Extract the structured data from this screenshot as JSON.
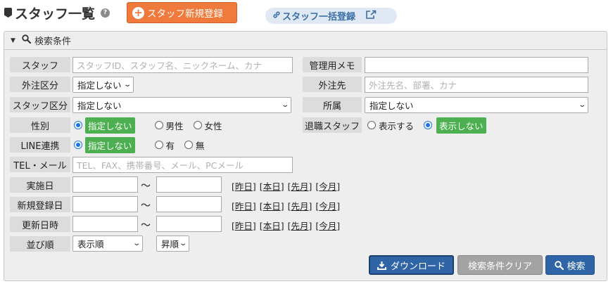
{
  "header": {
    "title": "スタッフ一覧",
    "help_icon": "?",
    "new_button": "スタッフ新規登録",
    "bulk_button": "スタッフ一括登録"
  },
  "panel": {
    "title": "検索条件"
  },
  "fields": {
    "staff": {
      "label": "スタッフ",
      "placeholder": "スタッフID、スタッフ名、ニックネーム、カナ"
    },
    "memo": {
      "label": "管理用メモ",
      "value": ""
    },
    "outsource_type": {
      "label": "外注区分",
      "value": "指定しない"
    },
    "outsource": {
      "label": "外注先",
      "placeholder": "外注先名、部署、カナ"
    },
    "staff_type": {
      "label": "スタッフ区分",
      "value": "指定しない"
    },
    "affiliation": {
      "label": "所属",
      "value": "指定しない"
    },
    "gender": {
      "label": "性別",
      "options": [
        "指定しない",
        "男性",
        "女性"
      ],
      "selected": "指定しない"
    },
    "retired": {
      "label": "退職スタッフ",
      "options": [
        "表示する",
        "表示しない"
      ],
      "selected": "表示しない"
    },
    "line": {
      "label": "LINE連携",
      "options": [
        "指定しない",
        "有",
        "無"
      ],
      "selected": "指定しない"
    },
    "tel": {
      "label": "TEL・メール",
      "placeholder": "TEL、FAX、携帯番号、メール、PCメール"
    },
    "date_rows": [
      {
        "label": "実施日"
      },
      {
        "label": "新規登録日"
      },
      {
        "label": "更新日時"
      }
    ],
    "date_separator": "～",
    "quick_links": [
      "昨日",
      "本日",
      "先月",
      "今月"
    ],
    "sort": {
      "label": "並び順",
      "value": "表示順",
      "order": "昇順"
    }
  },
  "actions": {
    "download": "ダウンロード",
    "clear": "検索条件クリア",
    "search": "検索"
  },
  "colors": {
    "accent_orange": "#f07a3c",
    "primary_blue": "#2f65a7",
    "selected_green": "#4caf50"
  }
}
